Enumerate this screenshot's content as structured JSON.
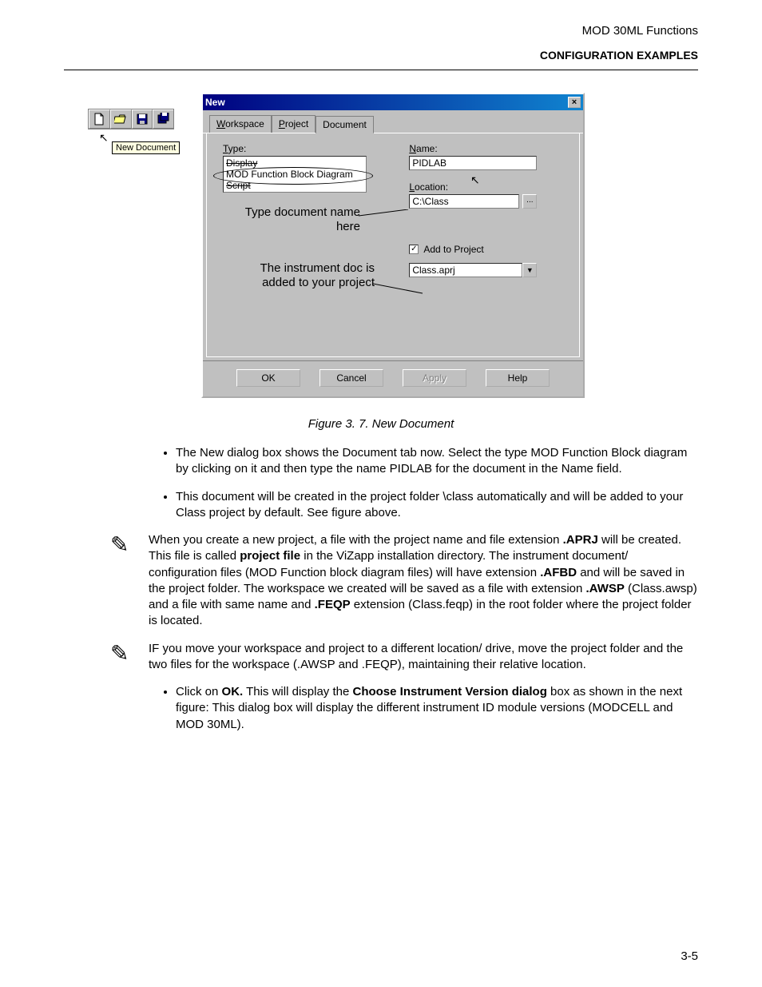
{
  "header": {
    "title": "MOD 30ML Functions",
    "section": "CONFIGURATION EXAMPLES"
  },
  "toolbar": {
    "tooltip": "New Document"
  },
  "dialog": {
    "title": "New",
    "tabs": {
      "workspace": "Workspace",
      "project": "Project",
      "document": "Document"
    },
    "type_label": "Type:",
    "type_items": {
      "display": "Display",
      "mod": "MOD Function Block Diagram",
      "script": "Script"
    },
    "name_label": "Name:",
    "name_value": "PIDLAB",
    "location_label": "Location:",
    "location_value": "C:\\Class",
    "add_to_project": "Add to Project",
    "project_combo": "Class.aprj",
    "buttons": {
      "ok": "OK",
      "cancel": "Cancel",
      "apply": "Apply",
      "help": "Help"
    },
    "annot1": "Type document name here",
    "annot2": "The instrument doc is added to your project"
  },
  "caption": "Figure 3. 7. New Document",
  "bullets": {
    "b1": "The New dialog box shows the Document tab now. Select the type MOD Function Block diagram by clicking on it and then type the name PIDLAB for the document in the Name field.",
    "b2": "This document will be created in the project folder \\class automatically and will be added to your Class project by default. See figure above."
  },
  "note1": {
    "p1a": "When you create a new project, a file with the project name and file extension ",
    "p1b": ".APRJ",
    "p1c": " will be created. This file is called ",
    "p1d": "project file",
    "p1e": " in the ViZapp installation directory. The instrument document/ configuration files (MOD Function block diagram files) will have extension ",
    "p1f": ".AFBD",
    "p1g": " and will be saved in the project folder. The workspace we created will be saved as a file with extension ",
    "p1h": ".AWSP",
    "p1i": " (Class.awsp) and a file with same name and ",
    "p1j": ".FEQP",
    "p1k": " extension (Class.feqp) in the root folder where the project folder is located."
  },
  "note2": "IF you move your workspace and project to a different location/ drive, move the project folder and the two files for the workspace (.AWSP and .FEQP), maintaining their relative location.",
  "bullet3": {
    "a": "Click on ",
    "b": "OK.",
    "c": " This will display the ",
    "d": "Choose Instrument Version dialog",
    "e": " box as shown in the next figure: This dialog box will display the different instrument ID module versions (MODCELL and MOD 30ML)."
  },
  "pagenum": "3-5"
}
